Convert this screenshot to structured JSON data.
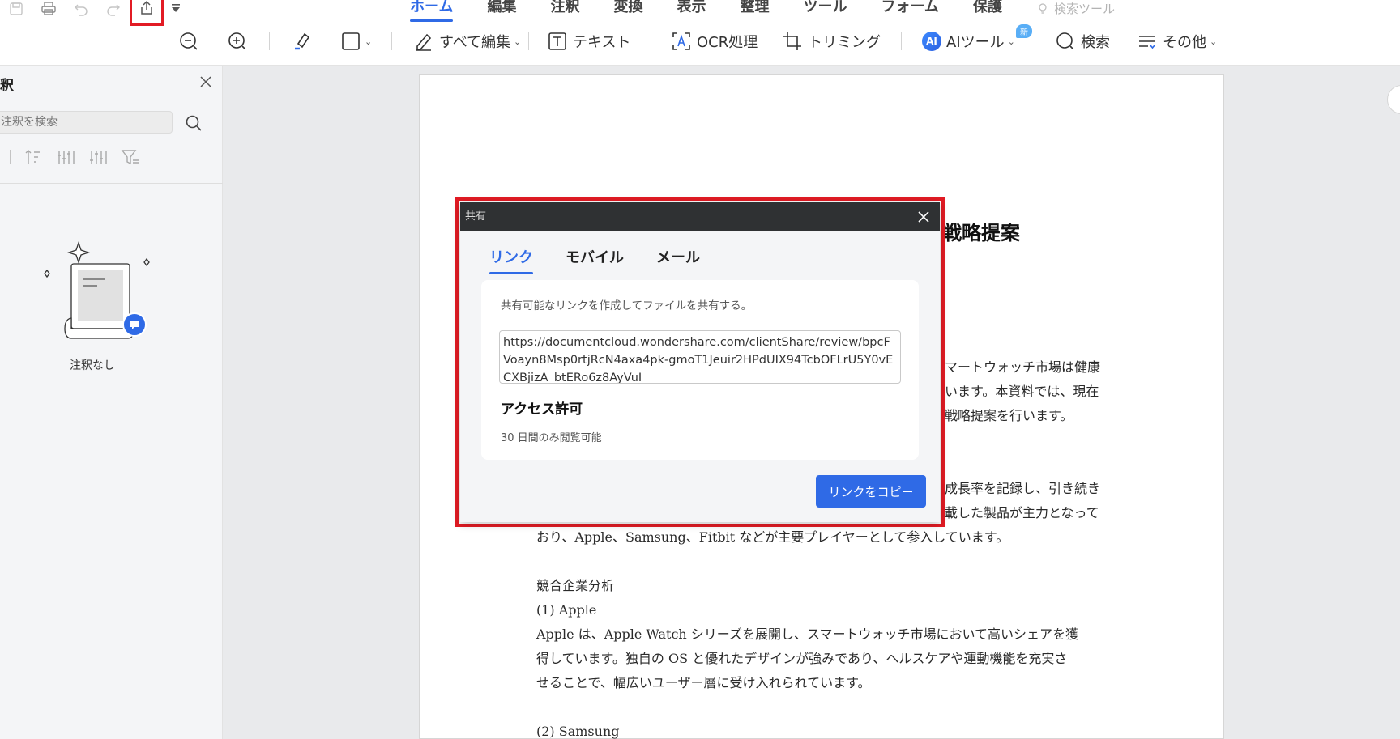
{
  "menu_tabs": [
    "ホーム",
    "編集",
    "注釈",
    "変換",
    "表示",
    "整理",
    "ツール",
    "フォーム",
    "保護"
  ],
  "search_tools_hint": "検索ツール",
  "toolbar": {
    "edit_all": "すべて編集",
    "text": "テキスト",
    "ocr": "OCR処理",
    "trim": "トリミング",
    "ai_badge": "AI",
    "ai_tools": "AIツール",
    "new_badge": "新",
    "search": "検索",
    "more": "その他"
  },
  "left_panel": {
    "title": "釈",
    "search_placeholder": "注釈を検索",
    "empty_text": "注釈なし"
  },
  "document": {
    "title_fragment": "戦略提案",
    "lines": [
      "マートウォッチ市場は健康",
      "います。本資料では、現在",
      "戦略提案を行います。",
      "成長率を記録し、引き続き",
      "載した製品が主力となって",
      "おり、Apple、Samsung、Fitbit などが主要プレイヤーとして参入しています。",
      "競合企業分析",
      "(1) Apple",
      "Apple は、Apple Watch シリーズを展開し、スマートウォッチ市場において高いシェアを獲",
      "得しています。独自の OS と優れたデザインが強みであり、ヘルスケアや運動機能を充実さ",
      "せることで、幅広いユーザー層に受け入れられています。",
      "(2) Samsung"
    ]
  },
  "share_dialog": {
    "title": "共有",
    "tabs": [
      "リンク",
      "モバイル",
      "メール"
    ],
    "description": "共有可能なリンクを作成してファイルを共有する。",
    "url": "https://documentcloud.wondershare.com/clientShare/review/bpcFVoayn8Msp0rtjRcN4axa4pk-gmoT1Jeuir2HPdUIX94TcbOFLrU5Y0vECXBjizA_btERo6z8AyVuI",
    "access_label": "アクセス許可",
    "access_detail": "30 日間のみ閲覧可能",
    "copy_button": "リンクをコピー"
  },
  "colors": {
    "accent": "#2f6ae6",
    "highlight_border": "#e21b24",
    "dialog_header": "#2f3133"
  }
}
